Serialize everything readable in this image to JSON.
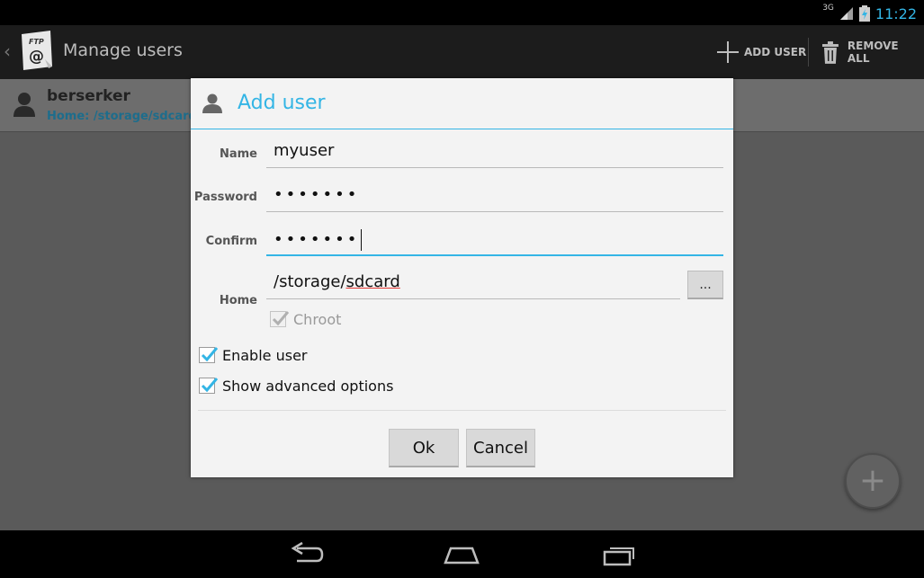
{
  "status_bar": {
    "network": "3G",
    "time": "11:22"
  },
  "action_bar": {
    "logo_text_top": "FTP",
    "logo_text_bottom": "@",
    "title": "Manage users",
    "add_user_label": "ADD USER",
    "remove_all_label": "REMOVE ALL"
  },
  "user_list": [
    {
      "name": "berserker",
      "home": "Home: /storage/sdcard"
    }
  ],
  "dialog": {
    "title": "Add user",
    "fields": {
      "name_label": "Name",
      "name_value": "myuser",
      "password_label": "Password",
      "password_value": "•••••••",
      "confirm_label": "Confirm",
      "confirm_value": "•••••••",
      "home_label": "Home",
      "home_value_prefix": "/storage/",
      "home_value_misspelled": "sdcard",
      "browse_label": "..."
    },
    "checkboxes": {
      "chroot_label": "Chroot",
      "chroot_checked": true,
      "chroot_enabled": false,
      "enable_user_label": "Enable user",
      "enable_user_checked": true,
      "show_advanced_label": "Show advanced options",
      "show_advanced_checked": true
    },
    "buttons": {
      "ok_label": "Ok",
      "cancel_label": "Cancel"
    }
  },
  "fab": {
    "icon": "plus-icon",
    "label": "+"
  },
  "colors": {
    "accent": "#33b5e5",
    "dialog_bg": "#f3f3f3",
    "action_bar_bg": "#1c1c1c",
    "dim_overlay_bg": "#5a5a5a"
  }
}
